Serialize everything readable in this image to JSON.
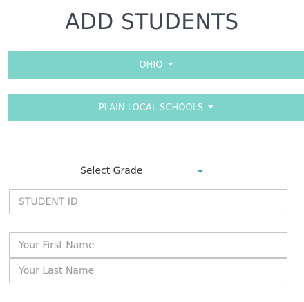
{
  "page": {
    "title": "ADD STUDENTS"
  },
  "state_dropdown": {
    "label": "OHIO"
  },
  "district_dropdown": {
    "label": "PLAIN LOCAL SCHOOLS"
  },
  "grade_select": {
    "label": "Select Grade"
  },
  "fields": {
    "student_id_placeholder": "STUDENT ID",
    "first_name_placeholder": "Your First Name",
    "last_name_placeholder": "Your Last Name"
  },
  "colors": {
    "accent": "#7ed3cb",
    "caret": "#45a2c4"
  }
}
